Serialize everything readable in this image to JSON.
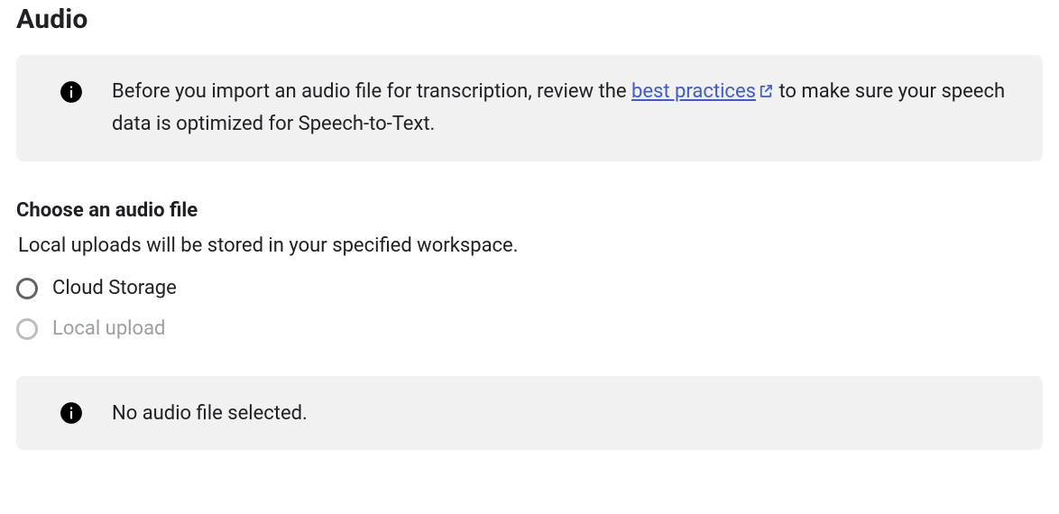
{
  "page": {
    "title": "Audio"
  },
  "info_banner": {
    "text_before_link": "Before you import an audio file for transcription, review the ",
    "link_text": "best practices",
    "text_after_link": " to make sure your speech data is optimized for Speech-to-Text."
  },
  "choose_section": {
    "subtitle": "Choose an audio file",
    "hint": "Local uploads will be stored in your specified workspace.",
    "options": {
      "cloud_storage": "Cloud Storage",
      "local_upload": "Local upload"
    }
  },
  "status_banner": {
    "message": "No audio file selected."
  }
}
